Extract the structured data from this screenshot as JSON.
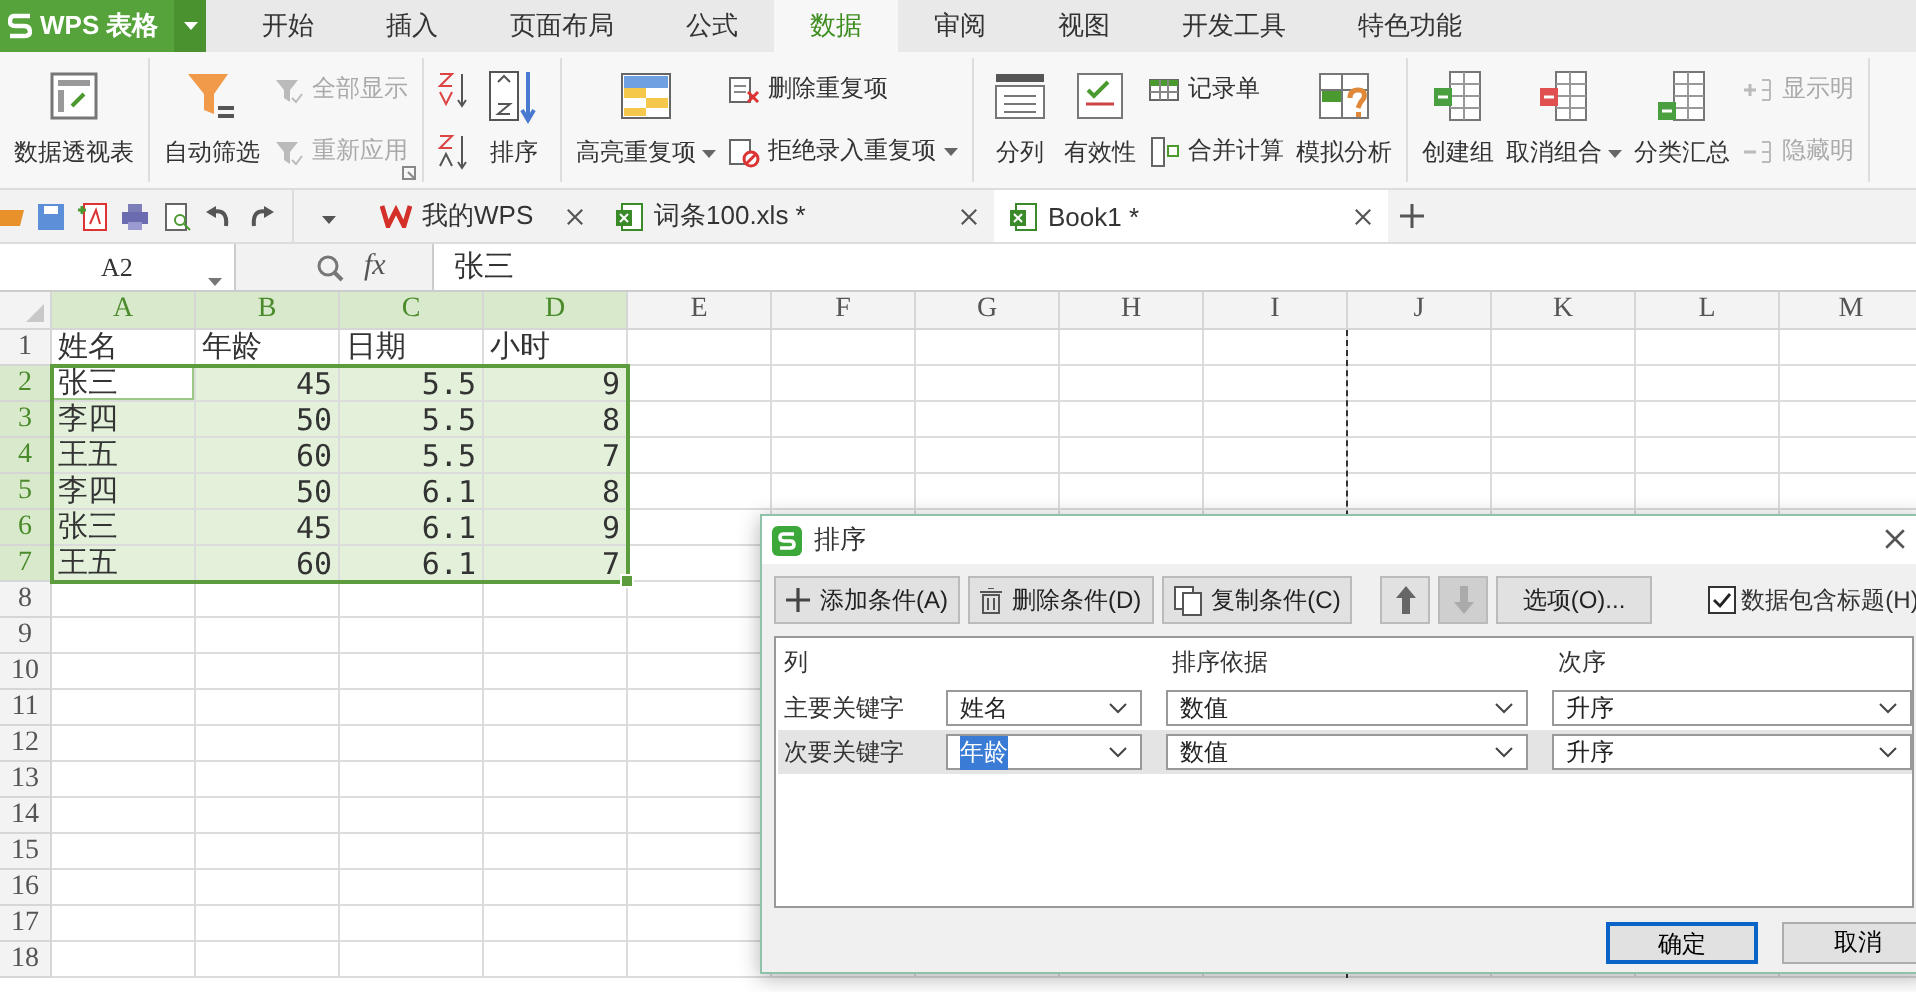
{
  "app_button": {
    "label": "WPS 表格"
  },
  "menu_tabs": [
    {
      "label": "开始",
      "selected": false
    },
    {
      "label": "插入",
      "selected": false
    },
    {
      "label": "页面布局",
      "selected": false
    },
    {
      "label": "公式",
      "selected": false
    },
    {
      "label": "数据",
      "selected": true
    },
    {
      "label": "审阅",
      "selected": false
    },
    {
      "label": "视图",
      "selected": false
    },
    {
      "label": "开发工具",
      "selected": false
    },
    {
      "label": "特色功能",
      "selected": false
    }
  ],
  "ribbon": {
    "groups": [
      {
        "items": [
          {
            "kind": "large",
            "label": "数据透视表",
            "disabled": false,
            "dropdown": false
          }
        ]
      },
      {
        "items": [
          {
            "kind": "large",
            "label": "自动筛选",
            "disabled": false,
            "dropdown": false
          },
          {
            "kind": "stack",
            "items": [
              {
                "label": "全部显示",
                "disabled": true,
                "dropdown": false
              },
              {
                "label": "重新应用",
                "disabled": true,
                "dropdown": false
              }
            ]
          },
          {
            "kind": "launcher"
          }
        ]
      },
      {
        "items": [
          {
            "kind": "sort_buttons"
          },
          {
            "kind": "large",
            "label": "排序",
            "disabled": false,
            "dropdown": false
          }
        ]
      },
      {
        "items": [
          {
            "kind": "large",
            "label": "高亮重复项",
            "disabled": false,
            "dropdown": true
          },
          {
            "kind": "stack",
            "items": [
              {
                "label": "删除重复项",
                "disabled": false,
                "dropdown": false
              },
              {
                "label": "拒绝录入重复项",
                "disabled": false,
                "dropdown": true
              }
            ]
          }
        ]
      },
      {
        "items": [
          {
            "kind": "large",
            "label": "分列",
            "disabled": false,
            "dropdown": false
          },
          {
            "kind": "large",
            "label": "有效性",
            "disabled": false,
            "dropdown": false
          },
          {
            "kind": "stack",
            "items": [
              {
                "label": "记录单",
                "disabled": false,
                "dropdown": false
              },
              {
                "label": "合并计算",
                "disabled": false,
                "dropdown": false
              }
            ]
          },
          {
            "kind": "large",
            "label": "模拟分析",
            "disabled": false,
            "dropdown": false
          }
        ]
      },
      {
        "items": [
          {
            "kind": "large",
            "label": "创建组",
            "disabled": false,
            "dropdown": false
          },
          {
            "kind": "large",
            "label": "取消组合",
            "disabled": false,
            "dropdown": true
          },
          {
            "kind": "large",
            "label": "分类汇总",
            "disabled": false,
            "dropdown": false
          },
          {
            "kind": "stack",
            "items": [
              {
                "label": "显示明",
                "disabled": true,
                "dropdown": false
              },
              {
                "label": "隐藏明",
                "disabled": true,
                "dropdown": false
              }
            ]
          }
        ]
      }
    ]
  },
  "doc_tabs": [
    {
      "kind": "wps",
      "label": "我的WPS",
      "selected": false
    },
    {
      "kind": "sheet",
      "label": "词条100.xls *",
      "selected": false
    },
    {
      "kind": "sheet",
      "label": "Book1 *",
      "selected": true
    }
  ],
  "formula_bar": {
    "name_box": "A2",
    "function_label": "fx",
    "content": "张三"
  },
  "sheet": {
    "columns": [
      {
        "label": "A",
        "selected": true
      },
      {
        "label": "B",
        "selected": true
      },
      {
        "label": "C",
        "selected": true
      },
      {
        "label": "D",
        "selected": true
      },
      {
        "label": "E",
        "selected": false
      },
      {
        "label": "F",
        "selected": false
      },
      {
        "label": "G",
        "selected": false
      },
      {
        "label": "H",
        "selected": false
      },
      {
        "label": "I",
        "selected": false
      },
      {
        "label": "J",
        "selected": false
      },
      {
        "label": "K",
        "selected": false
      },
      {
        "label": "L",
        "selected": false
      },
      {
        "label": "M",
        "selected": false
      }
    ],
    "rows": [
      {
        "label": "1",
        "selected": false,
        "cells": [
          {
            "text": "姓名",
            "kind": "text",
            "selected": false,
            "active": false
          },
          {
            "text": "年龄",
            "kind": "text",
            "selected": false,
            "active": false
          },
          {
            "text": "日期",
            "kind": "text",
            "selected": false,
            "active": false
          },
          {
            "text": "小时",
            "kind": "text",
            "selected": false,
            "active": false
          }
        ]
      },
      {
        "label": "2",
        "selected": true,
        "cells": [
          {
            "text": "张三",
            "kind": "text",
            "selected": true,
            "active": true
          },
          {
            "text": "45",
            "kind": "number",
            "selected": true,
            "active": false
          },
          {
            "text": "5.5",
            "kind": "number",
            "selected": true,
            "active": false
          },
          {
            "text": "9",
            "kind": "number",
            "selected": true,
            "active": false
          }
        ]
      },
      {
        "label": "3",
        "selected": true,
        "cells": [
          {
            "text": "李四",
            "kind": "text",
            "selected": true,
            "active": false
          },
          {
            "text": "50",
            "kind": "number",
            "selected": true,
            "active": false
          },
          {
            "text": "5.5",
            "kind": "number",
            "selected": true,
            "active": false
          },
          {
            "text": "8",
            "kind": "number",
            "selected": true,
            "active": false
          }
        ]
      },
      {
        "label": "4",
        "selected": true,
        "cells": [
          {
            "text": "王五",
            "kind": "text",
            "selected": true,
            "active": false
          },
          {
            "text": "60",
            "kind": "number",
            "selected": true,
            "active": false
          },
          {
            "text": "5.5",
            "kind": "number",
            "selected": true,
            "active": false
          },
          {
            "text": "7",
            "kind": "number",
            "selected": true,
            "active": false
          }
        ]
      },
      {
        "label": "5",
        "selected": true,
        "cells": [
          {
            "text": "李四",
            "kind": "text",
            "selected": true,
            "active": false
          },
          {
            "text": "50",
            "kind": "number",
            "selected": true,
            "active": false
          },
          {
            "text": "6.1",
            "kind": "number",
            "selected": true,
            "active": false
          },
          {
            "text": "8",
            "kind": "number",
            "selected": true,
            "active": false
          }
        ]
      },
      {
        "label": "6",
        "selected": true,
        "cells": [
          {
            "text": "张三",
            "kind": "text",
            "selected": true,
            "active": false
          },
          {
            "text": "45",
            "kind": "number",
            "selected": true,
            "active": false
          },
          {
            "text": "6.1",
            "kind": "number",
            "selected": true,
            "active": false
          },
          {
            "text": "9",
            "kind": "number",
            "selected": true,
            "active": false
          }
        ]
      },
      {
        "label": "7",
        "selected": true,
        "cells": [
          {
            "text": "王五",
            "kind": "text",
            "selected": true,
            "active": false
          },
          {
            "text": "60",
            "kind": "number",
            "selected": true,
            "active": false
          },
          {
            "text": "6.1",
            "kind": "number",
            "selected": true,
            "active": false
          },
          {
            "text": "7",
            "kind": "number",
            "selected": true,
            "active": false
          }
        ]
      },
      {
        "label": "8",
        "selected": false
      },
      {
        "label": "9",
        "selected": false
      },
      {
        "label": "10",
        "selected": false
      },
      {
        "label": "11",
        "selected": false
      },
      {
        "label": "12",
        "selected": false
      },
      {
        "label": "13",
        "selected": false
      },
      {
        "label": "14",
        "selected": false
      },
      {
        "label": "15",
        "selected": false
      },
      {
        "label": "16",
        "selected": false
      },
      {
        "label": "17",
        "selected": false
      },
      {
        "label": "18",
        "selected": false
      }
    ]
  },
  "dialog": {
    "title": "排序",
    "toolbar": [
      {
        "kind": "add",
        "label": "添加条件(A)",
        "disabled": false
      },
      {
        "kind": "delete",
        "label": "删除条件(D)",
        "disabled": false
      },
      {
        "kind": "copy",
        "label": "复制条件(C)",
        "disabled": false
      },
      {
        "kind": "up",
        "disabled": false
      },
      {
        "kind": "down",
        "disabled": true
      },
      {
        "kind": "text",
        "label": "选项(O)...",
        "disabled": false
      }
    ],
    "header_checkbox": {
      "label": "数据包含标题(H)",
      "checked": true
    },
    "columns": [
      "列",
      "排序依据",
      "次序"
    ],
    "rows": [
      {
        "label": "主要关键字",
        "column": "姓名",
        "basis": "数值",
        "order": "升序",
        "selected": false
      },
      {
        "label": "次要关键字",
        "column": "年龄",
        "basis": "数值",
        "order": "升序",
        "selected": true
      }
    ],
    "buttons": [
      {
        "label": "确定",
        "default": true
      },
      {
        "label": "取消",
        "default": false
      }
    ]
  }
}
